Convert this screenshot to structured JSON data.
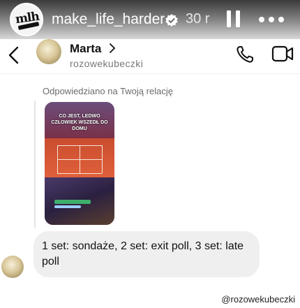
{
  "story": {
    "logo_text": "mlh",
    "username": "make_life_harder",
    "time": "30 r"
  },
  "dm": {
    "name": "Marta",
    "handle": "rozowekubeczki"
  },
  "chat": {
    "reply_caption": "Odpowiedziano na Twoją relację",
    "story_caption": "CO JEST, LEDWO CZŁOWIEK WSZEDŁ DO DOMU",
    "message": "1 set: sondaże, 2 set: exit poll, 3 set: late poll"
  },
  "footer": {
    "mention": "@rozowekubeczki"
  },
  "colors": {
    "verified": "#ffffff",
    "bubble": "#efefef",
    "court": "#d9573a"
  }
}
